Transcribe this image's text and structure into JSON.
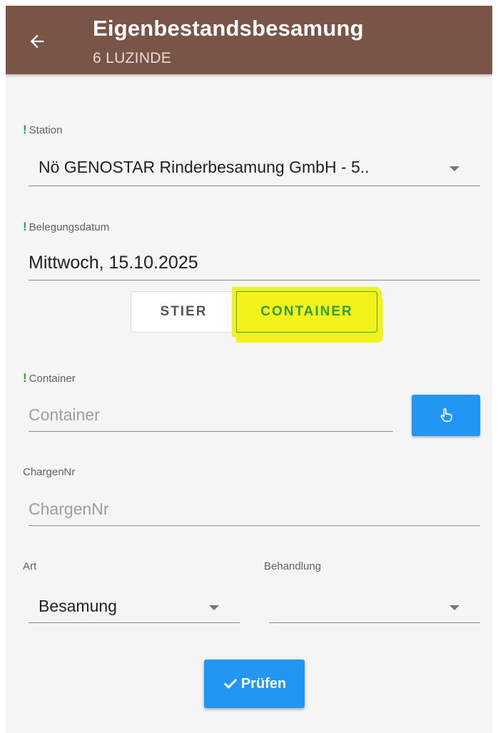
{
  "header": {
    "title": "Eigenbestandsbesamung",
    "subtitle": "6 LUZINDE",
    "back_icon": "arrow-left-icon"
  },
  "form": {
    "station": {
      "label": "Station",
      "value": "Nö GENOSTAR Rinderbesamung GmbH - 5..",
      "required": true
    },
    "belegungsdatum": {
      "label": "Belegungsdatum",
      "value": "Mittwoch, 15.10.2025",
      "required": true
    },
    "toggle": {
      "options": [
        "STIER",
        "CONTAINER"
      ],
      "selected": "CONTAINER"
    },
    "container": {
      "label": "Container",
      "placeholder": "Container",
      "required": true,
      "pick_icon": "hand-pointer-icon"
    },
    "chargennr": {
      "label": "ChargenNr",
      "placeholder": "ChargenNr"
    },
    "art": {
      "label": "Art",
      "value": "Besamung"
    },
    "behandlung": {
      "label": "Behandlung",
      "value": ""
    },
    "submit": {
      "label": "Prüfen",
      "icon": "check-icon"
    }
  },
  "colors": {
    "appbar": "#795548",
    "primary": "#2196f3",
    "required_mark": "#2e9e3e",
    "highlight": "#f3f21a"
  }
}
